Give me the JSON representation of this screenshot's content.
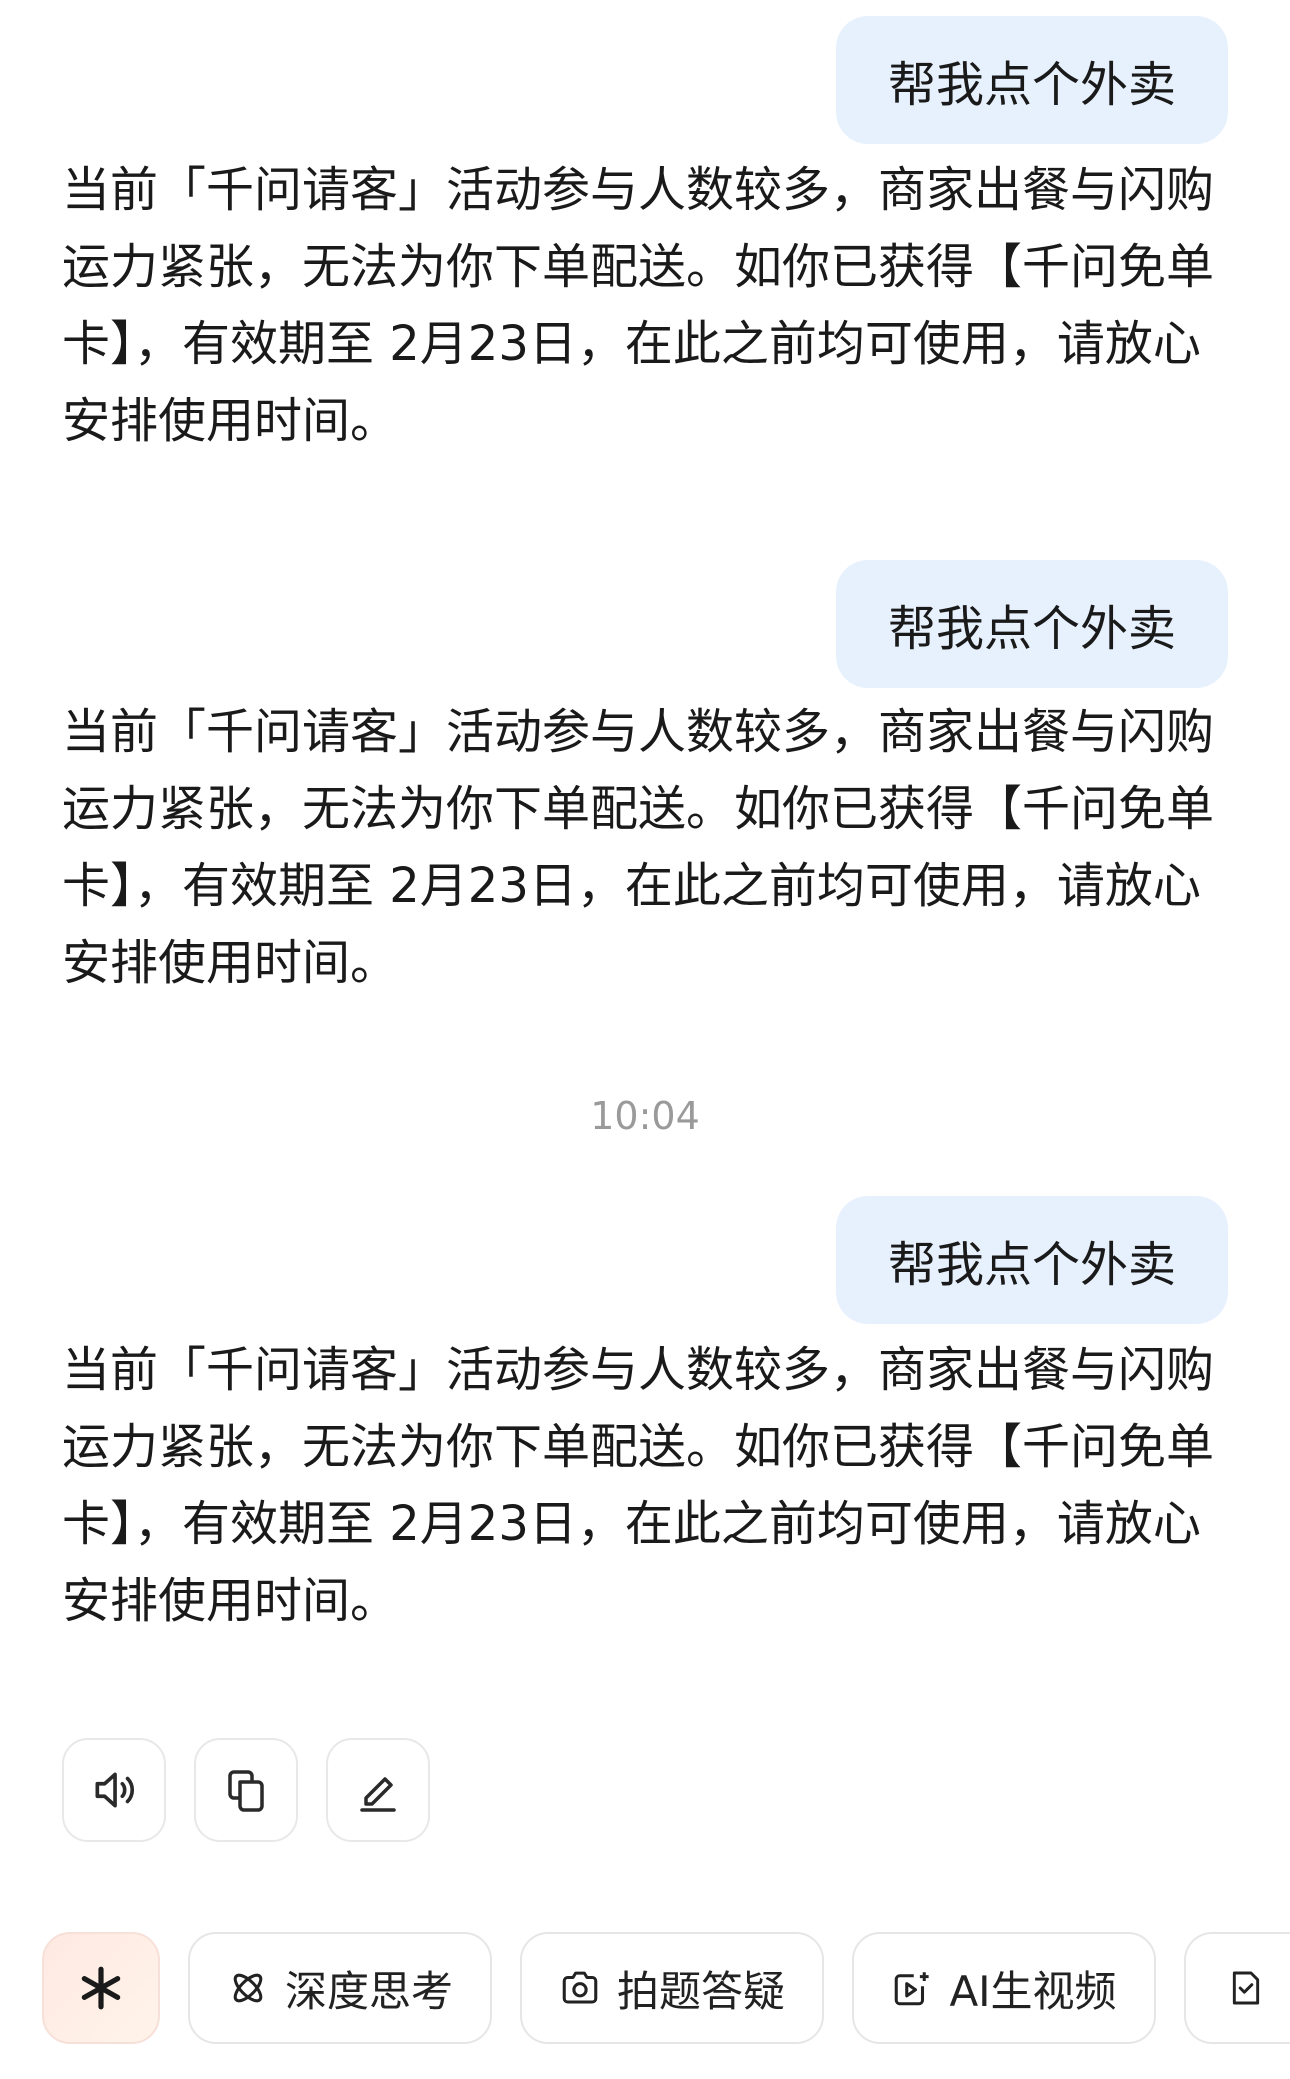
{
  "conversation": {
    "user_messages": [
      "帮我点个外卖",
      "帮我点个外卖",
      "帮我点个外卖"
    ],
    "ai_messages": [
      "当前「千问请客」活动参与人数较多，商家出餐与闪购运力紧张，无法为你下单配送。如你已获得【千问免单卡】，有效期至 2月23日，在此之前均可使用，请放心安排使用时间。",
      "当前「千问请客」活动参与人数较多，商家出餐与闪购运力紧张，无法为你下单配送。如你已获得【千问免单卡】，有效期至 2月23日，在此之前均可使用，请放心安排使用时间。",
      "当前「千问请客」活动参与人数较多，商家出餐与闪购运力紧张，无法为你下单配送。如你已获得【千问免单卡】，有效期至 2月23日，在此之前均可使用，请放心安排使用时间。"
    ],
    "timestamp": "10:04"
  },
  "message_actions": {
    "icons": [
      "speaker-icon",
      "copy-icon",
      "edit-icon"
    ]
  },
  "quick_chips": {
    "logo_icon": "spark-logo-icon",
    "items": [
      {
        "label": "深度思考",
        "icon": "deep-think-icon"
      },
      {
        "label": "拍题答疑",
        "icon": "camera-icon"
      },
      {
        "label": "AI生视频",
        "icon": "video-icon"
      }
    ],
    "partial_icon": "document-icon"
  },
  "colors": {
    "user_bubble_bg": "#e7f1fd",
    "timestamp_text": "#9a9a9a",
    "logo_accent": "#1a1a1a"
  }
}
